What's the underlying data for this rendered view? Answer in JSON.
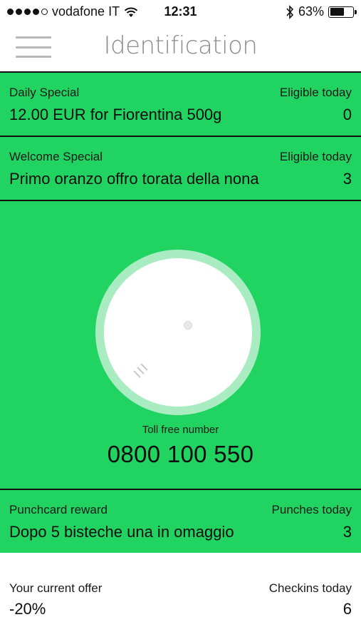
{
  "status_bar": {
    "carrier": "vodafone IT",
    "time": "12:31",
    "battery": "63%",
    "battery_level": 0.63,
    "icons": [
      "signal-dots-icon",
      "wifi-icon",
      "bluetooth-icon",
      "battery-icon"
    ]
  },
  "header": {
    "title": "Identification",
    "menu_icon": "hamburger-menu-icon"
  },
  "colors": {
    "accent_green": "#21d462",
    "dial_ring": "#a9ecc2",
    "title_gray": "#8c8c8c"
  },
  "daily_special": {
    "label": "Daily Special",
    "value": "12.00 EUR for Fiorentina 500g",
    "eligible_label": "Eligible today",
    "eligible_count": "0"
  },
  "welcome_special": {
    "label": "Welcome Special",
    "value": "Primo oranzo offro torata della nona",
    "eligible_label": "Eligible today",
    "eligible_count": "3"
  },
  "identification_dial": {
    "icon": "grip-lines-icon"
  },
  "toll_free": {
    "label": "Toll free number",
    "number": "0800 100 550"
  },
  "punchcard": {
    "label": "Punchcard reward",
    "value": "Dopo 5 bisteche una in omaggio",
    "count_label": "Punches today",
    "count": "3"
  },
  "current_offer": {
    "label": "Your current offer",
    "value": "-20%",
    "checkins_label": "Checkins today",
    "checkins": "6"
  }
}
